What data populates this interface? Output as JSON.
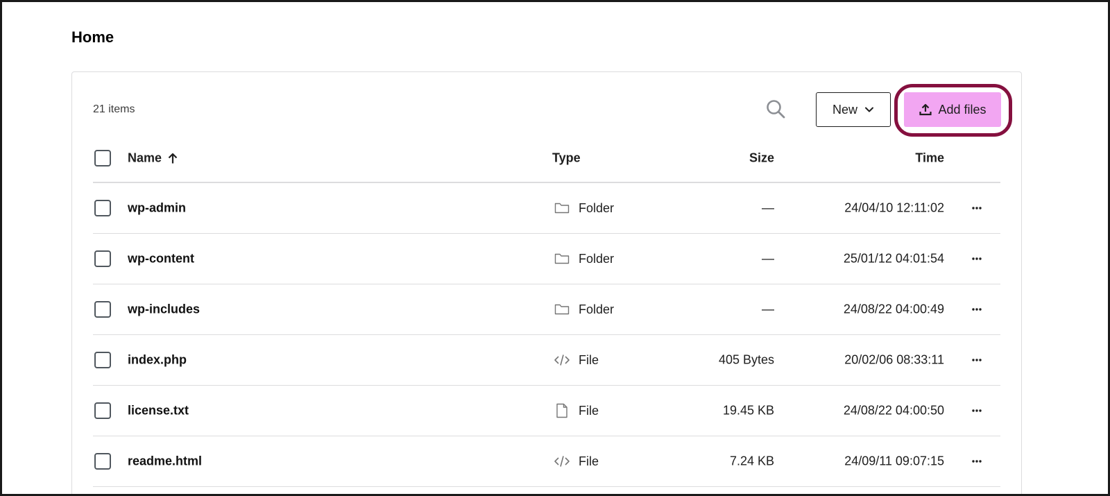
{
  "page": {
    "title": "Home"
  },
  "toolbar": {
    "item_count": "21 items",
    "search_icon": "search-icon",
    "new_label": "New",
    "new_icon": "chevron-down-icon",
    "add_files_label": "Add files",
    "add_files_icon": "upload-icon",
    "accent_color": "#f2a6f2",
    "highlight_color": "#85103f"
  },
  "table": {
    "headers": {
      "name": "Name",
      "type": "Type",
      "size": "Size",
      "time": "Time"
    },
    "sort_icon": "arrow-up-icon",
    "rows": [
      {
        "name": "wp-admin",
        "type": "Folder",
        "icon": "folder-icon",
        "size": "—",
        "time": "24/04/10 12:11:02"
      },
      {
        "name": "wp-content",
        "type": "Folder",
        "icon": "folder-icon",
        "size": "—",
        "time": "25/01/12 04:01:54"
      },
      {
        "name": "wp-includes",
        "type": "Folder",
        "icon": "folder-icon",
        "size": "—",
        "time": "24/08/22 04:00:49"
      },
      {
        "name": "index.php",
        "type": "File",
        "icon": "code-icon",
        "size": "405 Bytes",
        "time": "20/02/06 08:33:11"
      },
      {
        "name": "license.txt",
        "type": "File",
        "icon": "document-icon",
        "size": "19.45 KB",
        "time": "24/08/22 04:00:50"
      },
      {
        "name": "readme.html",
        "type": "File",
        "icon": "code-icon",
        "size": "7.24 KB",
        "time": "24/09/11 09:07:15"
      }
    ]
  }
}
